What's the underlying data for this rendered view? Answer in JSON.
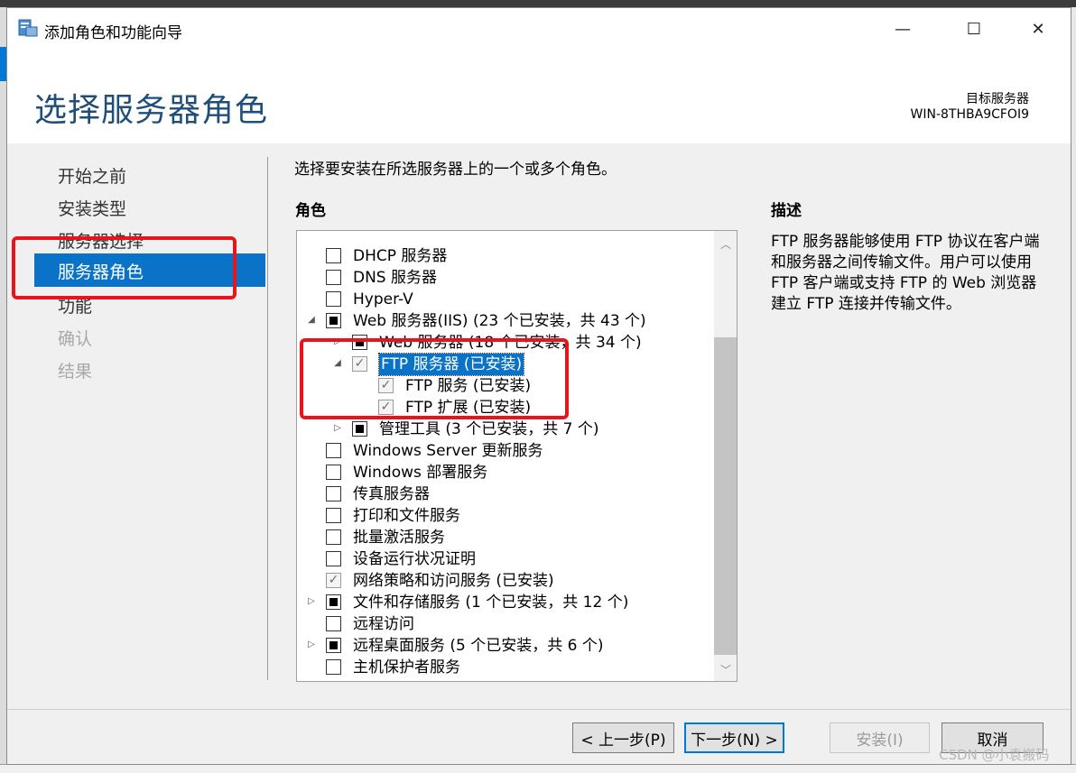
{
  "window": {
    "title": "添加角色和功能向导",
    "controls": {
      "minimize": "—",
      "maximize": "☐",
      "close": "✕"
    }
  },
  "header": {
    "page_title": "选择服务器角色",
    "target_label": "目标服务器",
    "target_name": "WIN-8THBA9CFOI9"
  },
  "nav": {
    "items": [
      {
        "label": "开始之前",
        "state": "normal"
      },
      {
        "label": "安装类型",
        "state": "normal"
      },
      {
        "label": "服务器选择",
        "state": "normal"
      },
      {
        "label": "服务器角色",
        "state": "active"
      },
      {
        "label": "功能",
        "state": "normal"
      },
      {
        "label": "确认",
        "state": "disabled"
      },
      {
        "label": "结果",
        "state": "disabled"
      }
    ]
  },
  "main": {
    "instruction": "选择要安装在所选服务器上的一个或多个角色。",
    "roles_header": "角色",
    "roles": [
      {
        "label": "DHCP 服务器",
        "state": "unchecked",
        "expander": ""
      },
      {
        "label": "DNS 服务器",
        "state": "unchecked",
        "expander": ""
      },
      {
        "label": "Hyper-V",
        "state": "unchecked",
        "expander": ""
      },
      {
        "label": "Web 服务器(IIS) (23 个已安装，共 43 个)",
        "state": "partial",
        "expander": "expanded"
      },
      {
        "label": "Web 服务器 (18 个已安装，共 34 个)",
        "state": "partial",
        "expander": "collapsed"
      },
      {
        "label": "FTP 服务器 (已安装)",
        "state": "checked",
        "expander": "expanded",
        "selected": true
      },
      {
        "label": "FTP 服务 (已安装)",
        "state": "checked",
        "expander": ""
      },
      {
        "label": "FTP 扩展 (已安装)",
        "state": "checked",
        "expander": ""
      },
      {
        "label": "管理工具 (3 个已安装，共 7 个)",
        "state": "partial",
        "expander": "collapsed"
      },
      {
        "label": "Windows Server 更新服务",
        "state": "unchecked",
        "expander": ""
      },
      {
        "label": "Windows 部署服务",
        "state": "unchecked",
        "expander": ""
      },
      {
        "label": "传真服务器",
        "state": "unchecked",
        "expander": ""
      },
      {
        "label": "打印和文件服务",
        "state": "unchecked",
        "expander": ""
      },
      {
        "label": "批量激活服务",
        "state": "unchecked",
        "expander": ""
      },
      {
        "label": "设备运行状况证明",
        "state": "unchecked",
        "expander": ""
      },
      {
        "label": "网络策略和访问服务 (已安装)",
        "state": "checked",
        "expander": ""
      },
      {
        "label": "文件和存储服务 (1 个已安装，共 12 个)",
        "state": "partial",
        "expander": "collapsed"
      },
      {
        "label": "远程访问",
        "state": "unchecked",
        "expander": ""
      },
      {
        "label": "远程桌面服务 (5 个已安装，共 6 个)",
        "state": "partial",
        "expander": "collapsed"
      },
      {
        "label": "主机保护者服务",
        "state": "unchecked",
        "expander": ""
      }
    ],
    "description_header": "描述",
    "description": "FTP 服务器能够使用 FTP 协议在客户端和服务器之间传输文件。用户可以使用 FTP 客户端或支持 FTP 的 Web 浏览器建立 FTP 连接并传输文件。"
  },
  "footer": {
    "prev": "< 上一步(P)",
    "next": "下一步(N) >",
    "install": "安装(I)",
    "cancel": "取消"
  },
  "watermark": "CSDN @小袁搬码",
  "colors": {
    "accent": "#0a73c8",
    "title": "#1e4e79",
    "highlight_box": "#e8141b"
  }
}
